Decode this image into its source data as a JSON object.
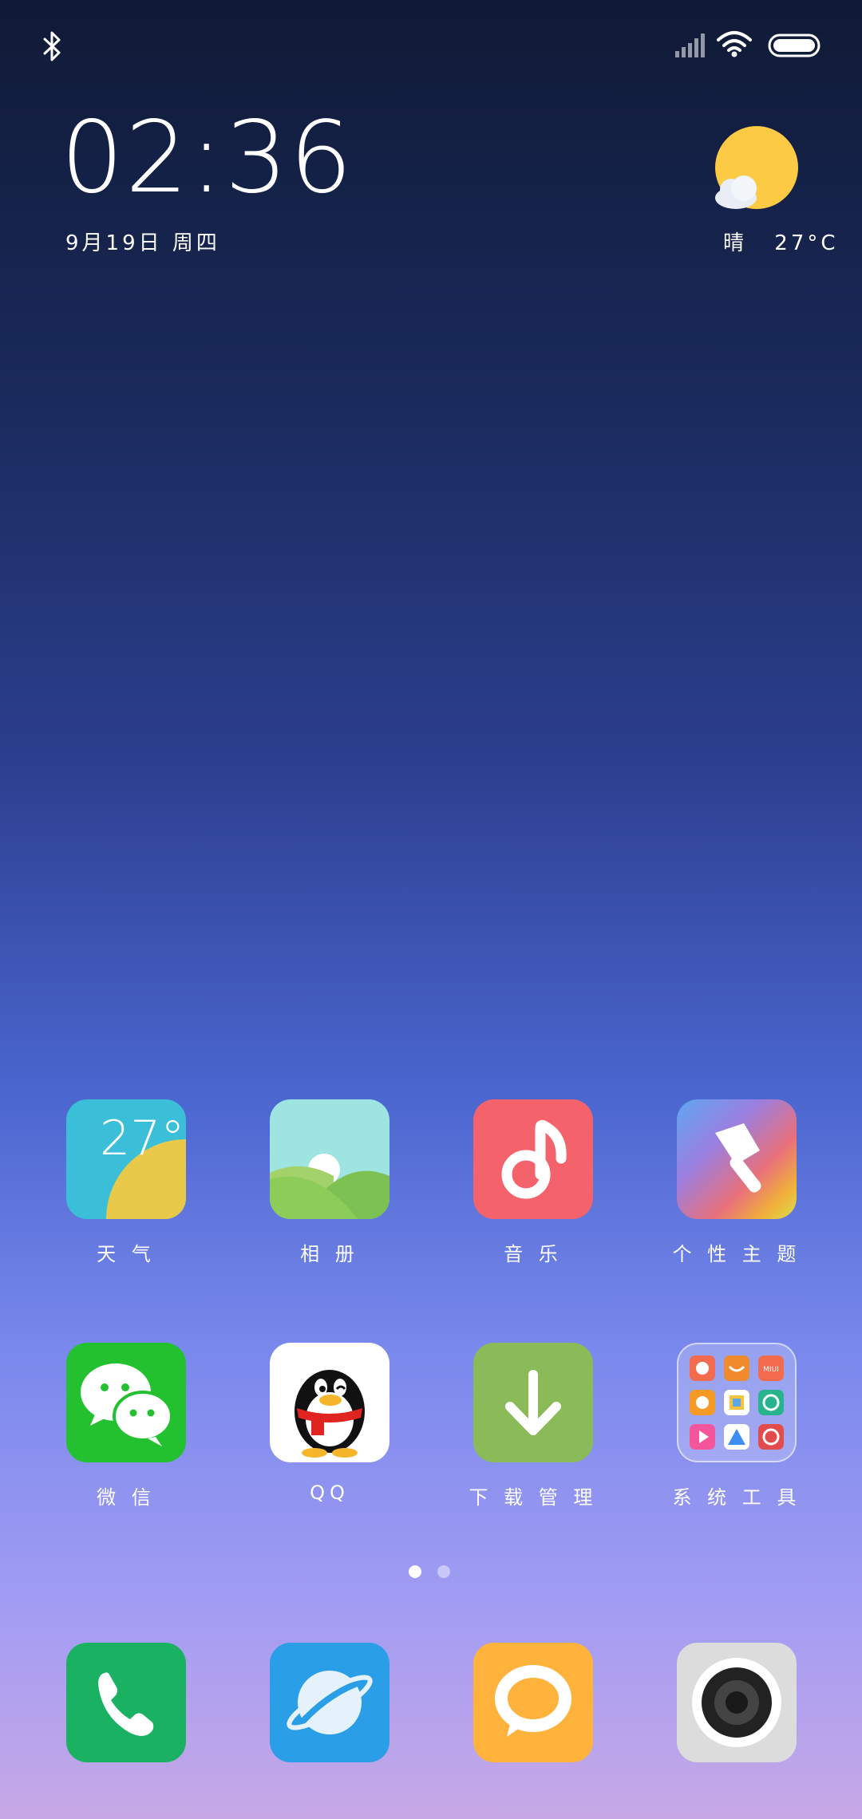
{
  "status_bar": {
    "icons": [
      "bluetooth-icon",
      "signal-icon",
      "wifi-icon",
      "battery-icon"
    ]
  },
  "clock_widget": {
    "time": "02:36",
    "date": "9月19日 周四"
  },
  "weather_widget": {
    "condition": "晴",
    "temperature": "27°C",
    "icon": "sun-cloud-icon"
  },
  "apps_row1": [
    {
      "label": "天 气",
      "icon": "weather-app-icon",
      "tile_text": "27°"
    },
    {
      "label": "相 册",
      "icon": "gallery-app-icon"
    },
    {
      "label": "音 乐",
      "icon": "music-app-icon"
    },
    {
      "label": "个 性 主 题",
      "icon": "themes-app-icon"
    }
  ],
  "apps_row2": [
    {
      "label": "微 信",
      "icon": "wechat-app-icon"
    },
    {
      "label": "QQ",
      "icon": "qq-app-icon"
    },
    {
      "label": "下 载 管 理",
      "icon": "download-app-icon"
    },
    {
      "label": "系 统 工 具",
      "icon": "folder-app-icon",
      "mini_text": "MIUI"
    }
  ],
  "page_indicator": {
    "pages": 2,
    "current": 1
  },
  "dock": [
    {
      "icon": "phone-app-icon"
    },
    {
      "icon": "browser-app-icon"
    },
    {
      "icon": "messages-app-icon"
    },
    {
      "icon": "camera-app-icon"
    }
  ],
  "colors": {
    "weather_tile": "#3bbfd8",
    "music_tile": "#f4636b",
    "wechat_tile": "#23c12f",
    "download_tile": "#8bba58",
    "phone_tile": "#1ab262",
    "browser_tile": "#2a9ee6",
    "messages_tile": "#ffb33c",
    "camera_tile": "#dcdcdc",
    "sun": "#fcca44"
  }
}
